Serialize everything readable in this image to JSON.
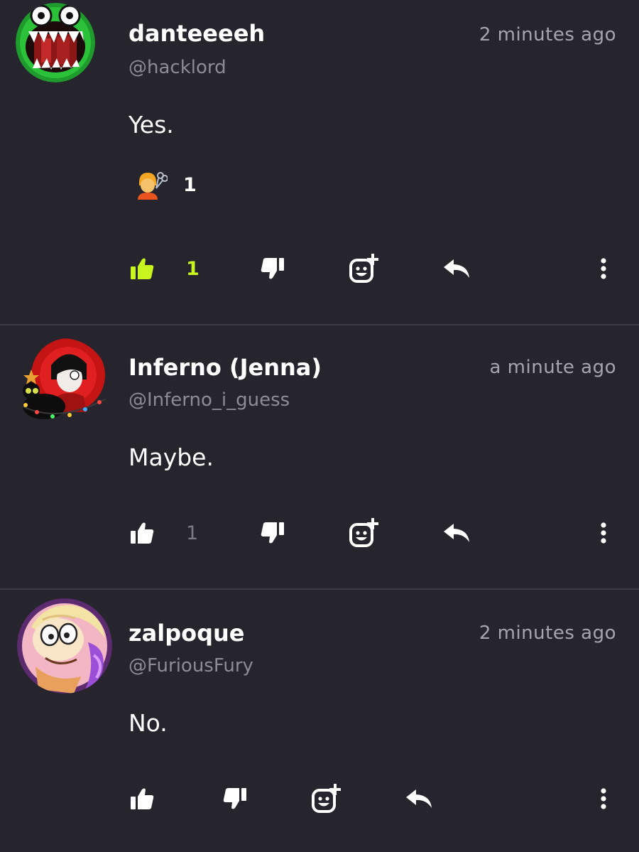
{
  "colors": {
    "background": "#26252d",
    "liked": "#c8f51e",
    "icon": "#ffffff",
    "muted_count": "#7c7b84",
    "divider": "#3c3b43"
  },
  "comments": [
    {
      "name": "danteeeeh",
      "handle": "@hacklord",
      "time": "2 minutes ago",
      "text": "Yes.",
      "reaction": {
        "emoji": "💇",
        "emoji_name": "haircut-emoji",
        "count": "1"
      },
      "likes": "1",
      "liked": true
    },
    {
      "name": "Inferno (Jenna)",
      "handle": "@Inferno_i_guess",
      "time": "a minute ago",
      "text": "Maybe.",
      "likes": "1",
      "liked": false
    },
    {
      "name": "zalpoque",
      "handle": "@FuriousFury",
      "time": "2 minutes ago",
      "text": "No.",
      "likes": "",
      "liked": false
    }
  ],
  "icons": {
    "like": "thumbs-up-icon",
    "dislike": "thumbs-down-icon",
    "react": "add-emoji-icon",
    "reply": "reply-icon",
    "more": "more-vertical-icon"
  }
}
